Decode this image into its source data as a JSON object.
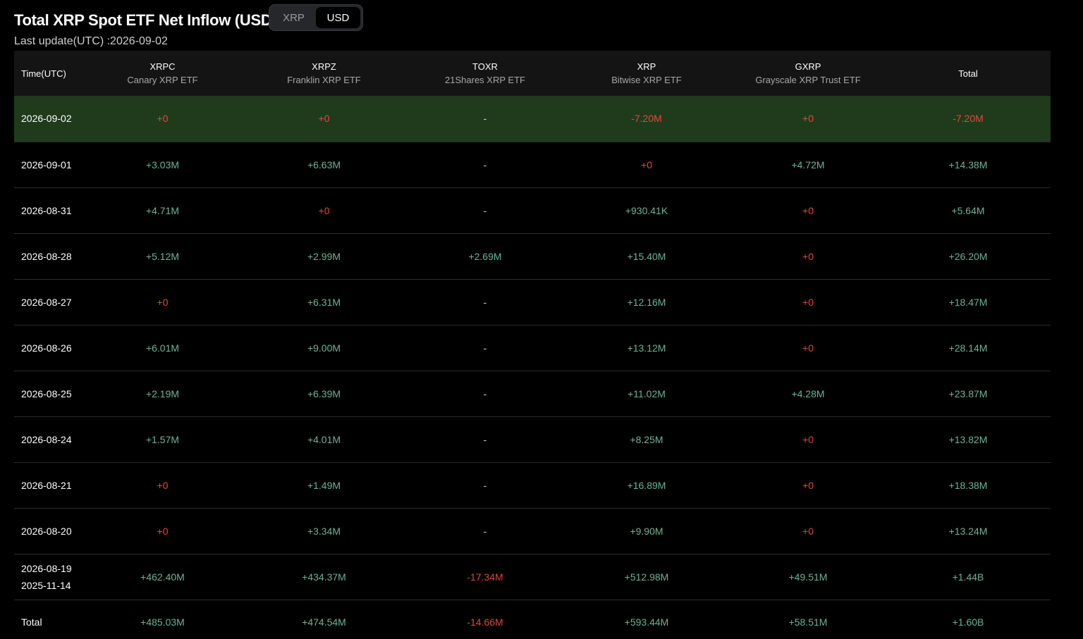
{
  "header": {
    "title": "Total XRP Spot ETF Net Inflow (USD)",
    "toggle": [
      "XRP",
      "USD"
    ],
    "active_toggle": "USD",
    "last_update": "Last update(UTC) :2026-09-02"
  },
  "colors": {
    "positive": "#6fb396",
    "negative": "#e0483e",
    "highlight_row": "#1f3b1c",
    "header_bg": "#141414"
  },
  "table": {
    "columns": [
      {
        "ticker": "Time(UTC)",
        "name": ""
      },
      {
        "ticker": "XRPC",
        "name": "Canary XRP ETF"
      },
      {
        "ticker": "XRPZ",
        "name": "Franklin XRP ETF"
      },
      {
        "ticker": "TOXR",
        "name": "21Shares XRP ETF"
      },
      {
        "ticker": "XRP",
        "name": "Bitwise XRP ETF"
      },
      {
        "ticker": "GXRP",
        "name": "Grayscale XRP Trust ETF"
      },
      {
        "ticker": "Total",
        "name": ""
      }
    ],
    "rows": [
      {
        "date": [
          "2026-09-02"
        ],
        "highlight": true,
        "values": [
          "+0",
          "+0",
          "-",
          "-7.20M",
          "+0",
          "-7.20M"
        ],
        "tones": [
          "neg",
          "neg",
          "dash",
          "neg",
          "neg",
          "neg"
        ]
      },
      {
        "date": [
          "2026-09-01"
        ],
        "values": [
          "+3.03M",
          "+6.63M",
          "-",
          "+0",
          "+4.72M",
          "+14.38M"
        ],
        "tones": [
          "pos",
          "pos",
          "dash",
          "neg",
          "pos",
          "pos"
        ]
      },
      {
        "date": [
          "2026-08-31"
        ],
        "values": [
          "+4.71M",
          "+0",
          "-",
          "+930.41K",
          "+0",
          "+5.64M"
        ],
        "tones": [
          "pos",
          "neg",
          "dash",
          "pos",
          "neg",
          "pos"
        ]
      },
      {
        "date": [
          "2026-08-28"
        ],
        "values": [
          "+5.12M",
          "+2.99M",
          "+2.69M",
          "+15.40M",
          "+0",
          "+26.20M"
        ],
        "tones": [
          "pos",
          "pos",
          "pos",
          "pos",
          "neg",
          "pos"
        ]
      },
      {
        "date": [
          "2026-08-27"
        ],
        "values": [
          "+0",
          "+6.31M",
          "-",
          "+12.16M",
          "+0",
          "+18.47M"
        ],
        "tones": [
          "neg",
          "pos",
          "dash",
          "pos",
          "neg",
          "pos"
        ]
      },
      {
        "date": [
          "2026-08-26"
        ],
        "values": [
          "+6.01M",
          "+9.00M",
          "-",
          "+13.12M",
          "+0",
          "+28.14M"
        ],
        "tones": [
          "pos",
          "pos",
          "dash",
          "pos",
          "neg",
          "pos"
        ]
      },
      {
        "date": [
          "2026-08-25"
        ],
        "values": [
          "+2.19M",
          "+6.39M",
          "-",
          "+11.02M",
          "+4.28M",
          "+23.87M"
        ],
        "tones": [
          "pos",
          "pos",
          "dash",
          "pos",
          "pos",
          "pos"
        ]
      },
      {
        "date": [
          "2026-08-24"
        ],
        "values": [
          "+1.57M",
          "+4.01M",
          "-",
          "+8.25M",
          "+0",
          "+13.82M"
        ],
        "tones": [
          "pos",
          "pos",
          "dash",
          "pos",
          "neg",
          "pos"
        ]
      },
      {
        "date": [
          "2026-08-21"
        ],
        "values": [
          "+0",
          "+1.49M",
          "-",
          "+16.89M",
          "+0",
          "+18.38M"
        ],
        "tones": [
          "neg",
          "pos",
          "dash",
          "pos",
          "neg",
          "pos"
        ]
      },
      {
        "date": [
          "2026-08-20"
        ],
        "values": [
          "+0",
          "+3.34M",
          "-",
          "+9.90M",
          "+0",
          "+13.24M"
        ],
        "tones": [
          "neg",
          "pos",
          "dash",
          "pos",
          "neg",
          "pos"
        ]
      },
      {
        "date": [
          "2026-08-19",
          "2025-11-14"
        ],
        "values": [
          "+462.40M",
          "+434.37M",
          "-17.34M",
          "+512.98M",
          "+49.51M",
          "+1.44B"
        ],
        "tones": [
          "pos",
          "pos",
          "neg",
          "pos",
          "pos",
          "pos"
        ]
      },
      {
        "date": [
          "Total"
        ],
        "total": true,
        "values": [
          "+485.03M",
          "+474.54M",
          "-14.66M",
          "+593.44M",
          "+58.51M",
          "+1.60B"
        ],
        "tones": [
          "pos",
          "pos",
          "neg",
          "pos",
          "pos",
          "pos"
        ]
      }
    ]
  }
}
